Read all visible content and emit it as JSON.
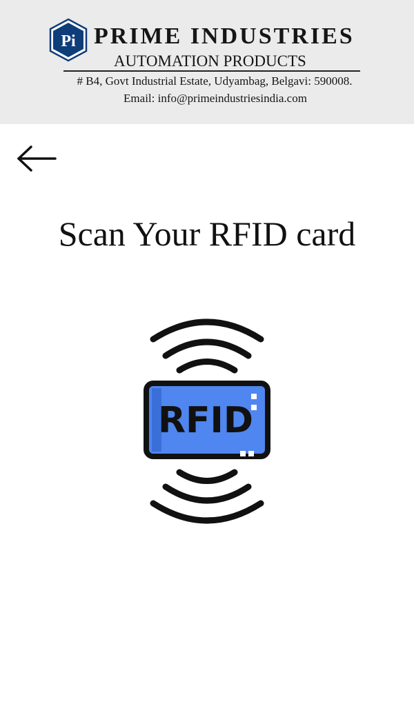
{
  "header": {
    "logo_text": "Pi",
    "company_name": "PRIME INDUSTRIES",
    "company_subtitle": "AUTOMATION PRODUCTS",
    "address": "# B4, Govt Industrial Estate, Udyambag, Belgavi: 590008.",
    "email": "Email: info@primeindustriesindia.com",
    "logo_color": "#0f3d7a",
    "background_color": "#ebebeb"
  },
  "navigation": {
    "back_icon": "arrow-left-icon"
  },
  "main": {
    "title": "Scan Your RFID card",
    "card_label": "RFID",
    "card_icon": "rfid-card-icon",
    "card_color": "#4f86f0"
  }
}
